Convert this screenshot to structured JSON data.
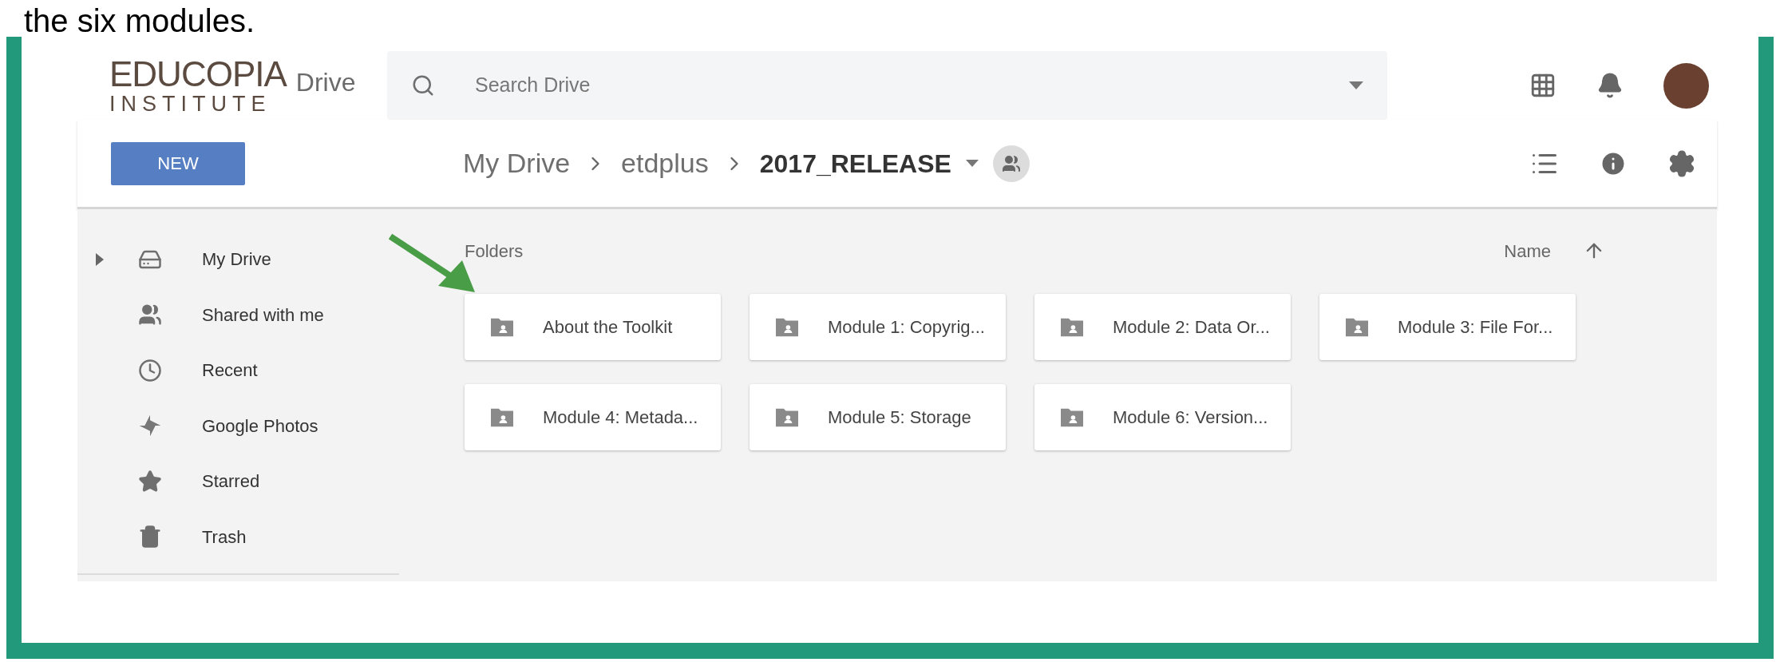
{
  "caption": "the six modules.",
  "logo": {
    "name": "EDUCOPIA",
    "subtitle": "INSTITUTE",
    "product": "Drive"
  },
  "search": {
    "placeholder": "Search Drive"
  },
  "new_button": "NEW",
  "breadcrumb": [
    "My Drive",
    "etdplus",
    "2017_RELEASE"
  ],
  "sidebar": {
    "items": [
      {
        "label": "My Drive",
        "kind": "drive",
        "expandable": true,
        "selected": false
      },
      {
        "label": "Shared with me",
        "kind": "shared",
        "expandable": false,
        "selected": false
      },
      {
        "label": "Recent",
        "kind": "recent",
        "expandable": false,
        "selected": false
      },
      {
        "label": "Google Photos",
        "kind": "photos",
        "expandable": false,
        "selected": false
      },
      {
        "label": "Starred",
        "kind": "starred",
        "expandable": false,
        "selected": false
      },
      {
        "label": "Trash",
        "kind": "trash",
        "expandable": false,
        "selected": false
      }
    ]
  },
  "content": {
    "section_label": "Folders",
    "sort_label": "Name",
    "folders": [
      {
        "name": "About the Toolkit",
        "highlighted": true
      },
      {
        "name": "Module 1: Copyrig...",
        "highlighted": false
      },
      {
        "name": "Module 2: Data Or...",
        "highlighted": false
      },
      {
        "name": "Module 3: File For...",
        "highlighted": false
      },
      {
        "name": "Module 4: Metada...",
        "highlighted": false
      },
      {
        "name": "Module 5: Storage",
        "highlighted": false
      },
      {
        "name": "Module 6: Version...",
        "highlighted": false
      }
    ]
  }
}
